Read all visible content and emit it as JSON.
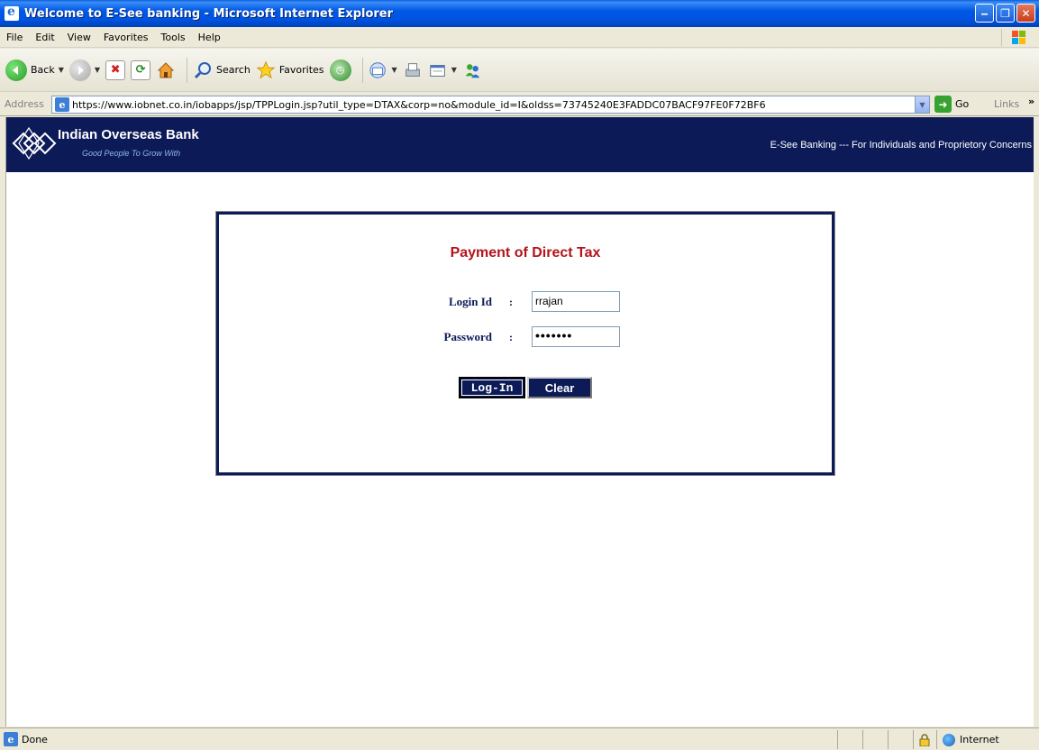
{
  "window": {
    "title": "Welcome to E-See banking - Microsoft Internet Explorer",
    "minimize_glyph": "‒",
    "maximize_glyph": "❐",
    "close_glyph": "✕"
  },
  "menubar": {
    "items": [
      "File",
      "Edit",
      "View",
      "Favorites",
      "Tools",
      "Help"
    ]
  },
  "toolbar": {
    "back_label": "Back",
    "search_label": "Search",
    "favorites_label": "Favorites",
    "icons": [
      "back-arrow-icon",
      "forward-arrow-icon",
      "stop-icon",
      "refresh-icon",
      "home-icon",
      "search-icon",
      "favorites-star-icon",
      "history-icon",
      "mail-icon",
      "print-icon",
      "edit-icon",
      "messenger-icon"
    ]
  },
  "addressbar": {
    "label": "Address",
    "url": "https://www.iobnet.co.in/iobapps/jsp/TPPLogin.jsp?util_type=DTAX&corp=no&module_id=I&oldss=73745240E3FADDC07BACF97FE0F72BF6",
    "go_label": "Go",
    "links_label": "Links",
    "links_chevron": "»"
  },
  "bank": {
    "name": "Indian Overseas Bank",
    "tagline": "Good People To Grow With",
    "service_text": "E-See Banking --- For Individuals and Proprietory Concerns",
    "header_color": "#0c1b58"
  },
  "login": {
    "title": "Payment of Direct Tax",
    "login_id_label": "Login Id",
    "login_id_value": "rrajan",
    "password_label": "Password",
    "password_value": "•••••••",
    "colon": ":",
    "login_button": "Log-In",
    "clear_button": "Clear",
    "title_color": "#b3141c"
  },
  "statusbar": {
    "text": "Done",
    "zone": "Internet"
  }
}
